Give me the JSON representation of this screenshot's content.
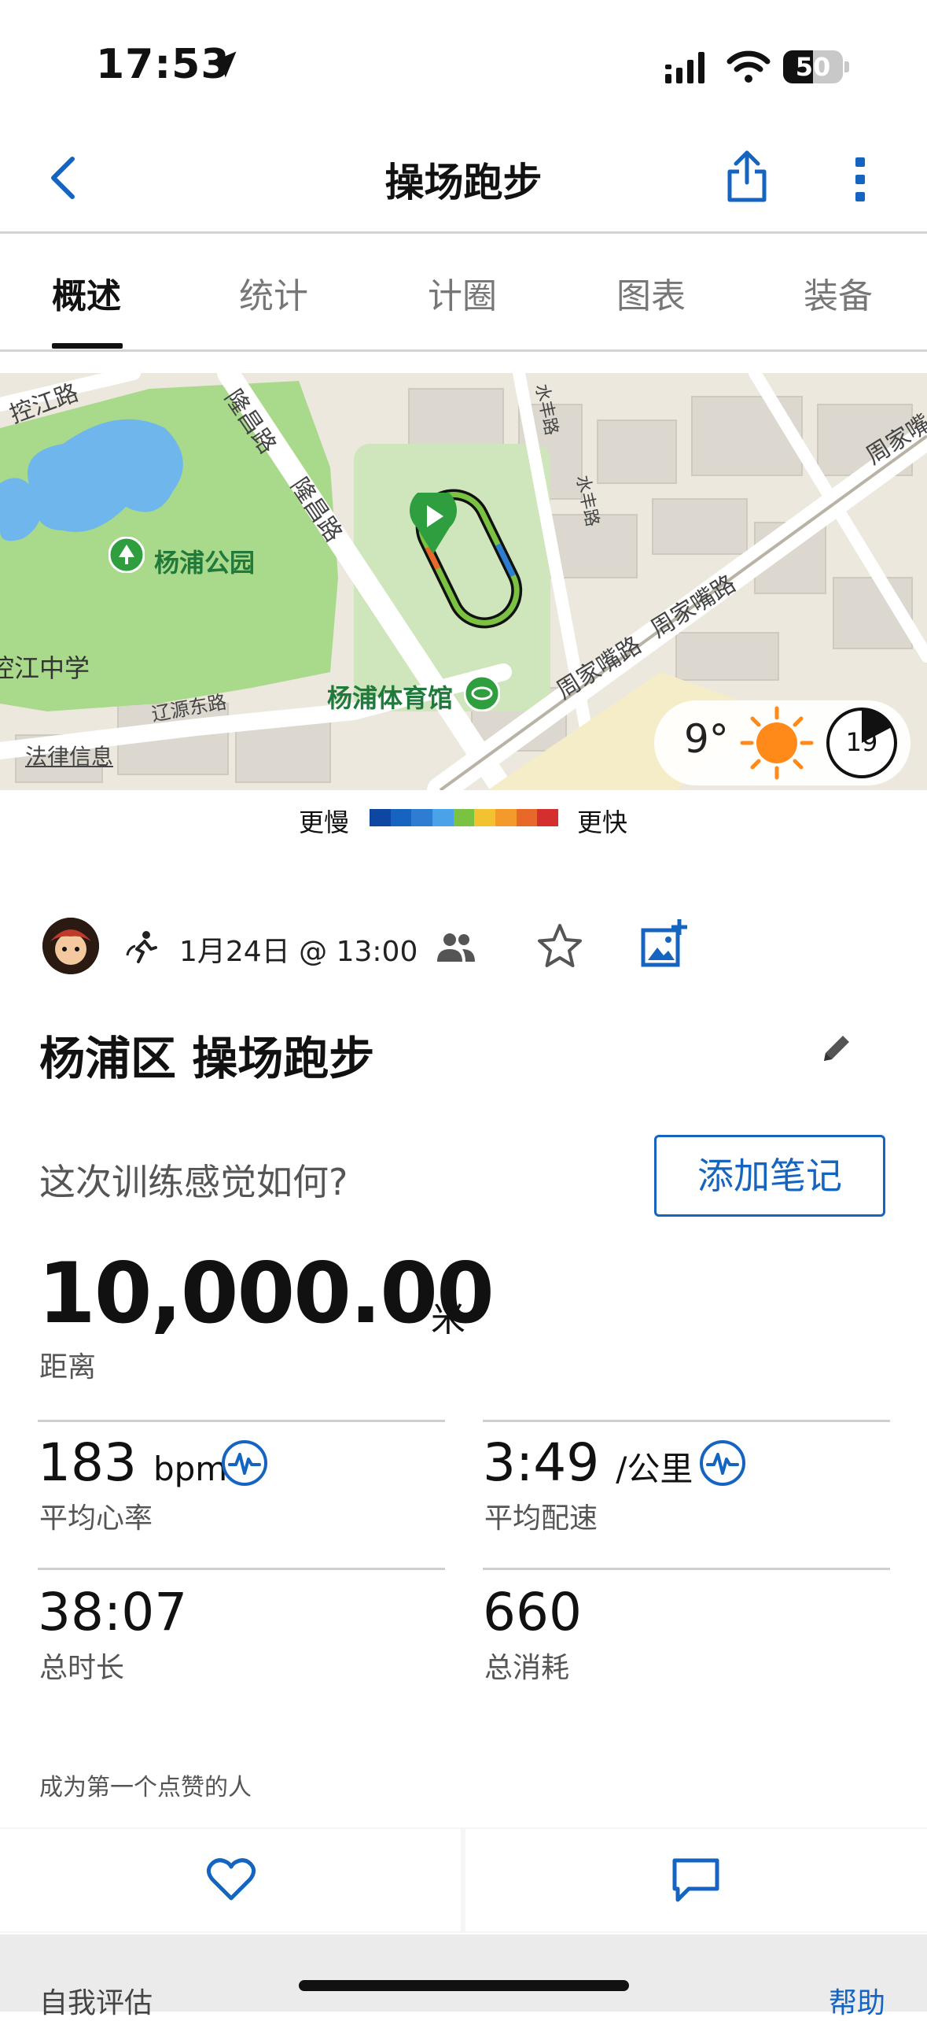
{
  "status_bar": {
    "time": "17:53",
    "battery": "50"
  },
  "header": {
    "title": "操场跑步"
  },
  "tabs": [
    {
      "label": "概述",
      "active": true
    },
    {
      "label": "统计",
      "active": false
    },
    {
      "label": "计圈",
      "active": false
    },
    {
      "label": "图表",
      "active": false
    },
    {
      "label": "装备",
      "active": false
    }
  ],
  "map": {
    "labels": {
      "kongjiang_road": "控江路",
      "longchang_road_1": "隆昌路",
      "longchang_road_2": "隆昌路",
      "shuifeng_road_1": "水丰路",
      "shuifeng_road_2": "水丰路",
      "zhoujiazui_road_1": "周家嘴路",
      "zhoujiazui_road_2": "周家嘴路",
      "zhoujiazui_road_3": "周家嘴",
      "yangpu_park": "杨浦公园",
      "kongjiang_school": "控江中学",
      "liaoyuan_east_road": "辽源东路",
      "yangpu_stadium": "杨浦体育馆",
      "legal_info": "法律信息"
    },
    "weather": {
      "temperature": "9°",
      "wind": "19"
    }
  },
  "pace_legend": {
    "slow_label": "更慢",
    "fast_label": "更快",
    "colors": [
      "#0d47a1",
      "#1565c0",
      "#2d7dd2",
      "#4aa3e8",
      "#7cc242",
      "#f2c230",
      "#f39a2b",
      "#e8682a",
      "#d32f2f"
    ]
  },
  "activity": {
    "date": "1月24日 @ 13:00",
    "title": "杨浦区 操场跑步",
    "feeling_prompt": "这次训练感觉如何?",
    "add_notes_label": "添加笔记",
    "distance_value": "10,000.00",
    "distance_unit": "米",
    "distance_label": "距离"
  },
  "stats": {
    "heart_rate": {
      "value": "183",
      "unit": "bpm",
      "label": "平均心率"
    },
    "pace": {
      "value": "3:49",
      "unit": "/公里",
      "label": "平均配速"
    },
    "duration": {
      "value": "38:07",
      "label": "总时长"
    },
    "calories": {
      "value": "660",
      "label": "总消耗"
    }
  },
  "kudos_prompt": "成为第一个点赞的人",
  "bottom": {
    "self_eval": "自我评估",
    "help": "帮助"
  },
  "colors": {
    "accent": "#1565c0",
    "park_green": "#a9d98a",
    "route_green": "#7cc242",
    "start_green": "#2e9e3e",
    "weather_sun": "#ff8a1a"
  }
}
